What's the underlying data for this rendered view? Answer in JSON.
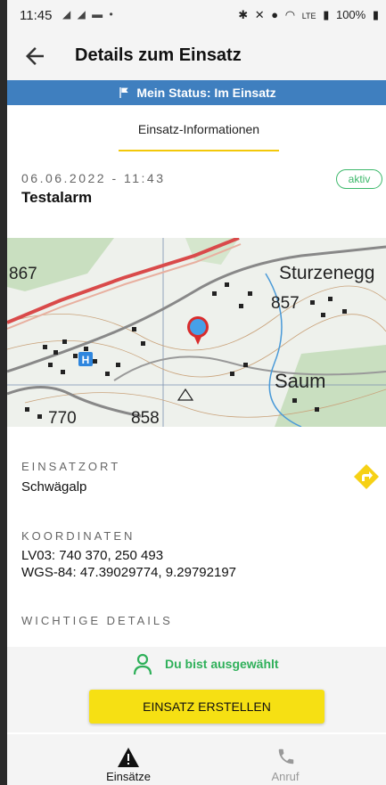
{
  "statusbar": {
    "time": "11:45",
    "battery": "100%",
    "network": "LTE"
  },
  "appbar": {
    "title": "Details zum Einsatz",
    "back_icon": "arrow-back-icon"
  },
  "status_strip": {
    "text": "Mein Status: Im Einsatz",
    "icon": "flag-icon",
    "color": "#3f7fbf"
  },
  "tabs": [
    {
      "label": "Einsatz-Informationen",
      "active": true
    }
  ],
  "incident": {
    "datetime": "06.06.2022 - 11:43",
    "title": "Testalarm",
    "badge": "aktiv"
  },
  "map": {
    "place_labels": [
      "Sturzenegg",
      "Saum"
    ],
    "spot_heights": [
      "867",
      "857",
      "770",
      "858"
    ]
  },
  "sections": {
    "location_label": "EINSATZORT",
    "location_value": "Schwägalp",
    "coords_label": "KOORDINATEN",
    "coords_lv03": "LV03: 740 370, 250 493",
    "coords_wgs84": "WGS-84: 47.39029774, 9.29792197",
    "details_label": "WICHTIGE DETAILS"
  },
  "selection": {
    "text": "Du bist ausgewählt",
    "color": "#2fb05a"
  },
  "create_button": {
    "label": "EINSATZ ERSTELLEN",
    "color": "#f6e013"
  },
  "bottom_nav": [
    {
      "label": "Einsätze",
      "icon": "warning-icon",
      "active": true
    },
    {
      "label": "Anruf",
      "icon": "phone-icon",
      "active": false
    }
  ]
}
